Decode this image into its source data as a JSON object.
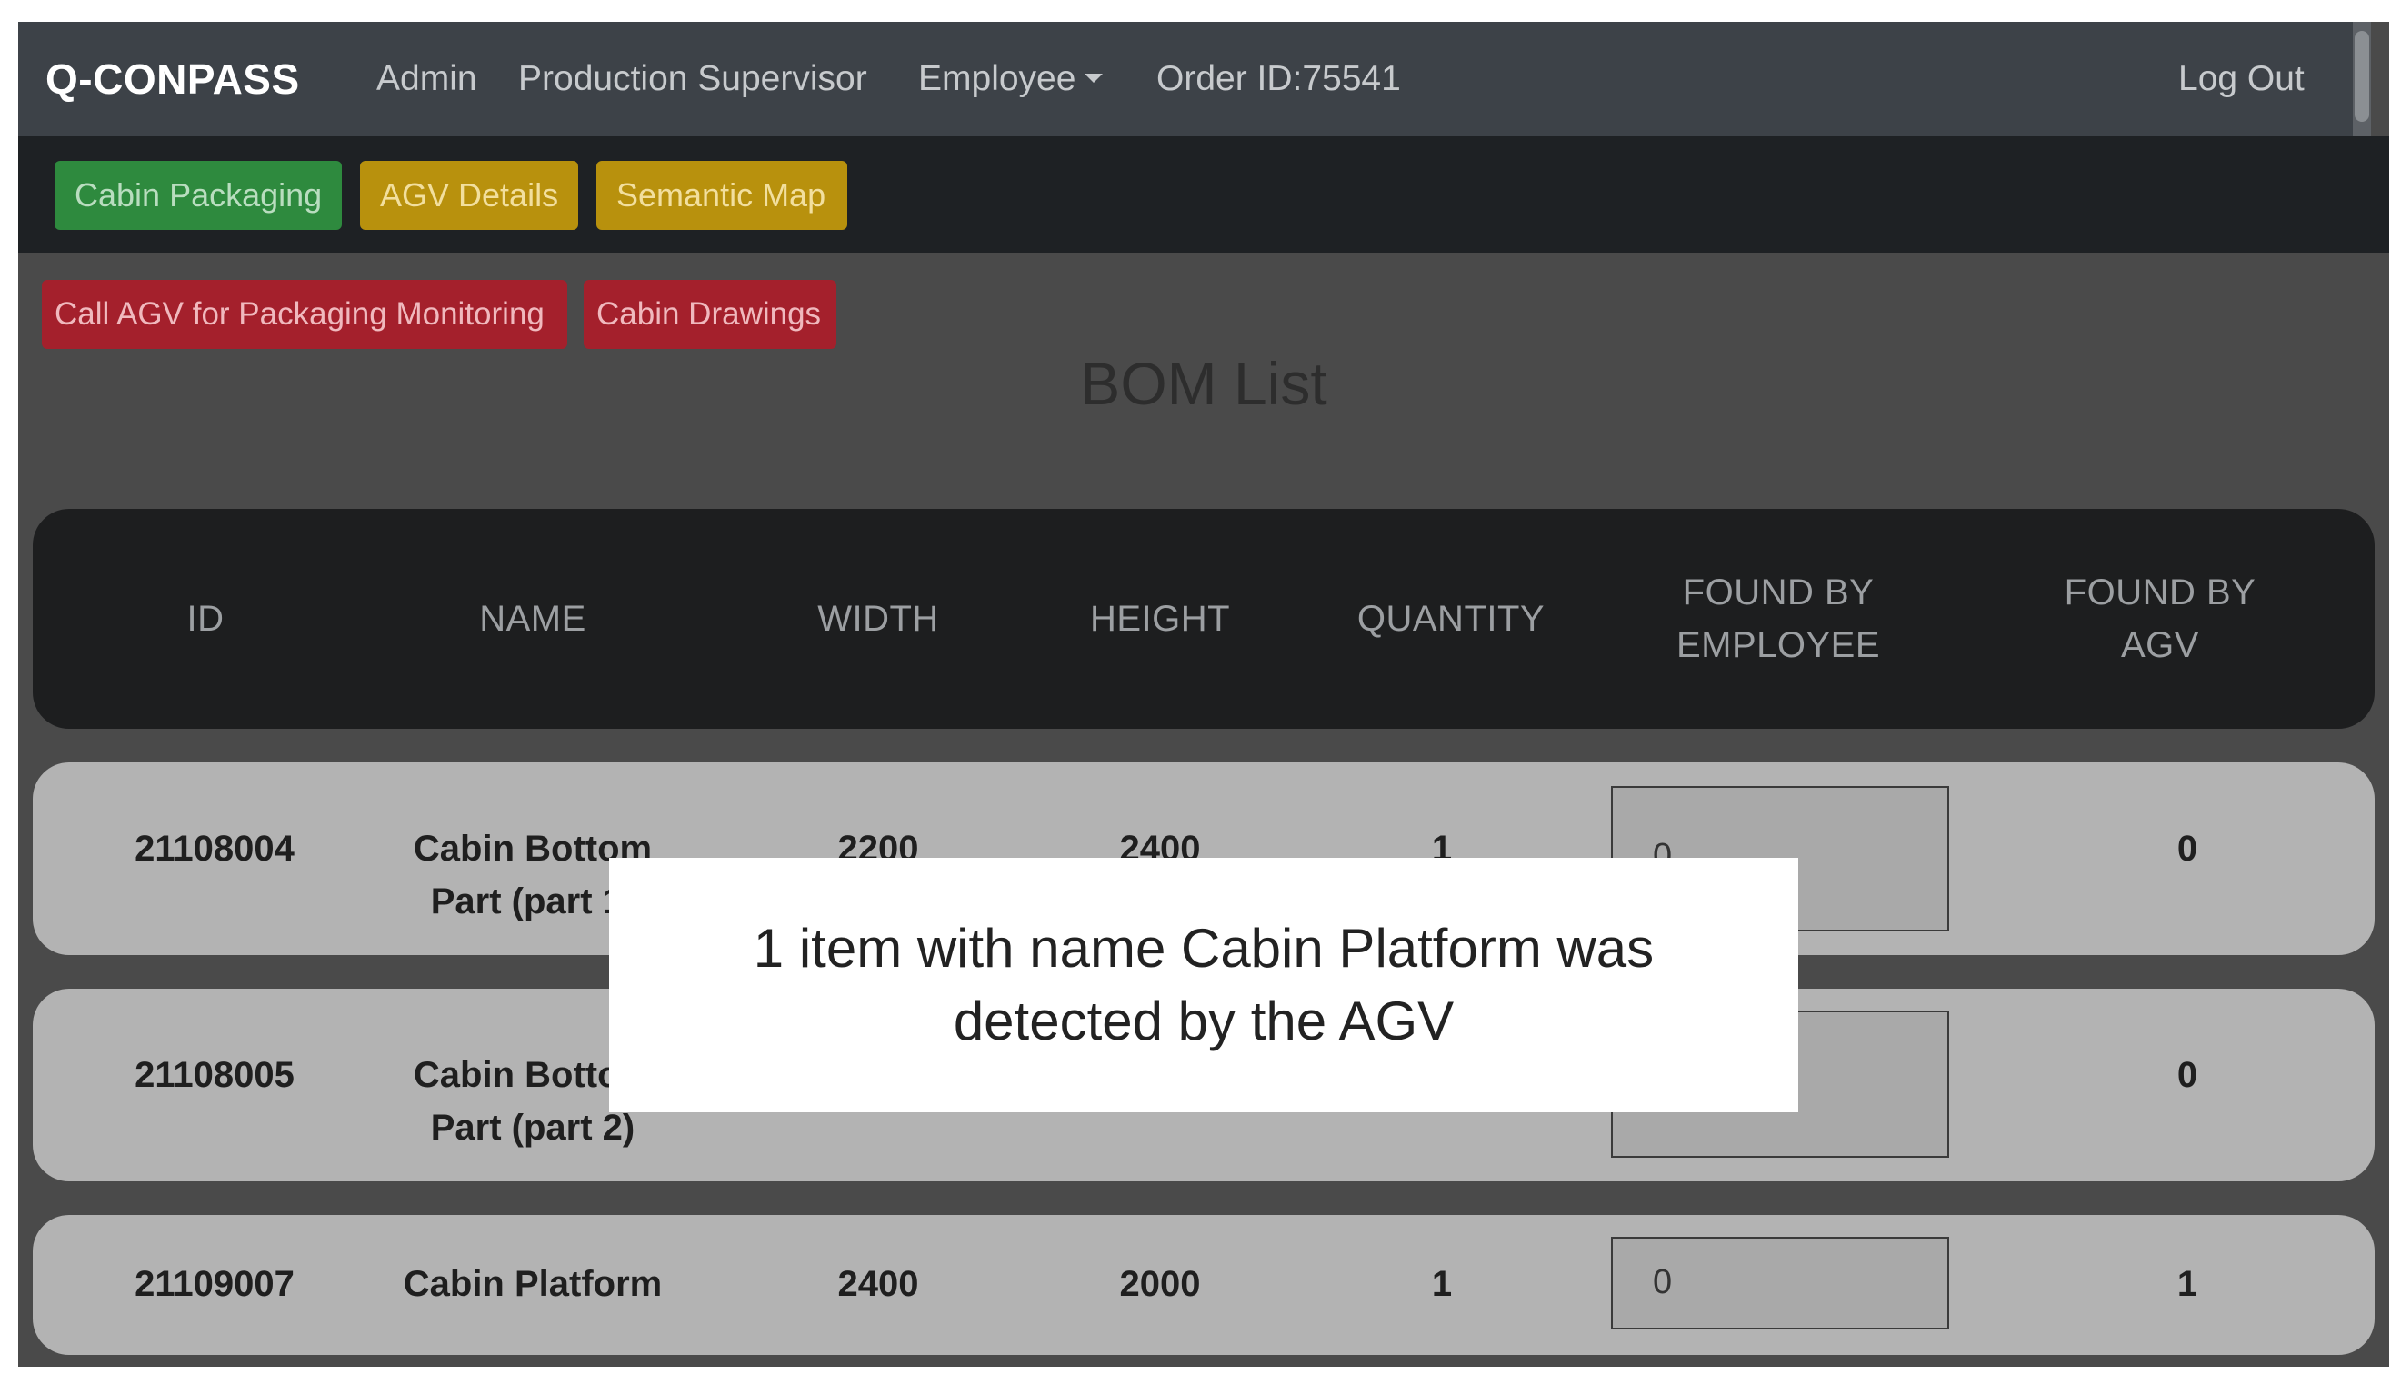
{
  "navbar": {
    "brand": "Q-CONPASS",
    "links": [
      "Admin",
      "Production Supervisor",
      "Employee",
      "Order ID:75541"
    ],
    "logout": "Log Out"
  },
  "toolbar": {
    "cabin_packaging": "Cabin Packaging",
    "agv_details": "AGV Details",
    "semantic_map": "Semantic Map"
  },
  "actions": {
    "call_agv": "Call AGV for Packaging Monitoring",
    "cabin_drawings": "Cabin Drawings"
  },
  "page": {
    "title": "BOM List"
  },
  "table": {
    "headers": [
      "ID",
      "NAME",
      "WIDTH",
      "HEIGHT",
      "QUANTITY",
      "FOUND BY EMPLOYEE",
      "FOUND BY AGV"
    ],
    "rows": [
      {
        "id": "21108004",
        "name": "Cabin Bottom Part (part 1)",
        "width": "2200",
        "height": "2400",
        "quantity": "1",
        "found_by_employee": "0",
        "found_by_agv": "0"
      },
      {
        "id": "21108005",
        "name": "Cabin Bottom Part (part 2)",
        "width": "",
        "height": "",
        "quantity": "",
        "found_by_employee": "",
        "found_by_agv": "0"
      },
      {
        "id": "21109007",
        "name": "Cabin Platform",
        "width": "2400",
        "height": "2000",
        "quantity": "1",
        "found_by_employee": "0",
        "found_by_agv": "1"
      }
    ]
  },
  "alert": {
    "message": "1 item with name Cabin Platform was detected by the AGV"
  },
  "colors": {
    "navbar_bg": "#3d4248",
    "toolbar_bg": "#1e2124",
    "success": "#2e8a3e",
    "warning": "#b8910d",
    "danger": "#a4202c"
  }
}
